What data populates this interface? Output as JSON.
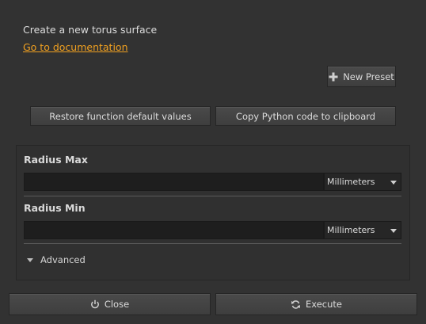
{
  "description": "Create a new torus surface",
  "doc_link": "Go to documentation",
  "buttons": {
    "new_preset": "New Preset",
    "restore_defaults": "Restore function default values",
    "copy_python": "Copy Python code to clipboard",
    "close": "Close",
    "execute": "Execute"
  },
  "params": {
    "radius_max": {
      "label": "Radius Max",
      "value": "",
      "unit": "Millimeters"
    },
    "radius_min": {
      "label": "Radius Min",
      "value": "",
      "unit": "Millimeters"
    }
  },
  "advanced": {
    "label": "Advanced"
  },
  "icons": {
    "new_preset": "plus-icon",
    "close": "power-icon",
    "execute": "refresh-icon",
    "dropdown": "chevron-down-icon",
    "advanced": "triangle-down-icon"
  },
  "colors": {
    "background": "#323232",
    "link": "#f0a020",
    "input_bg": "#1e1e1e"
  }
}
